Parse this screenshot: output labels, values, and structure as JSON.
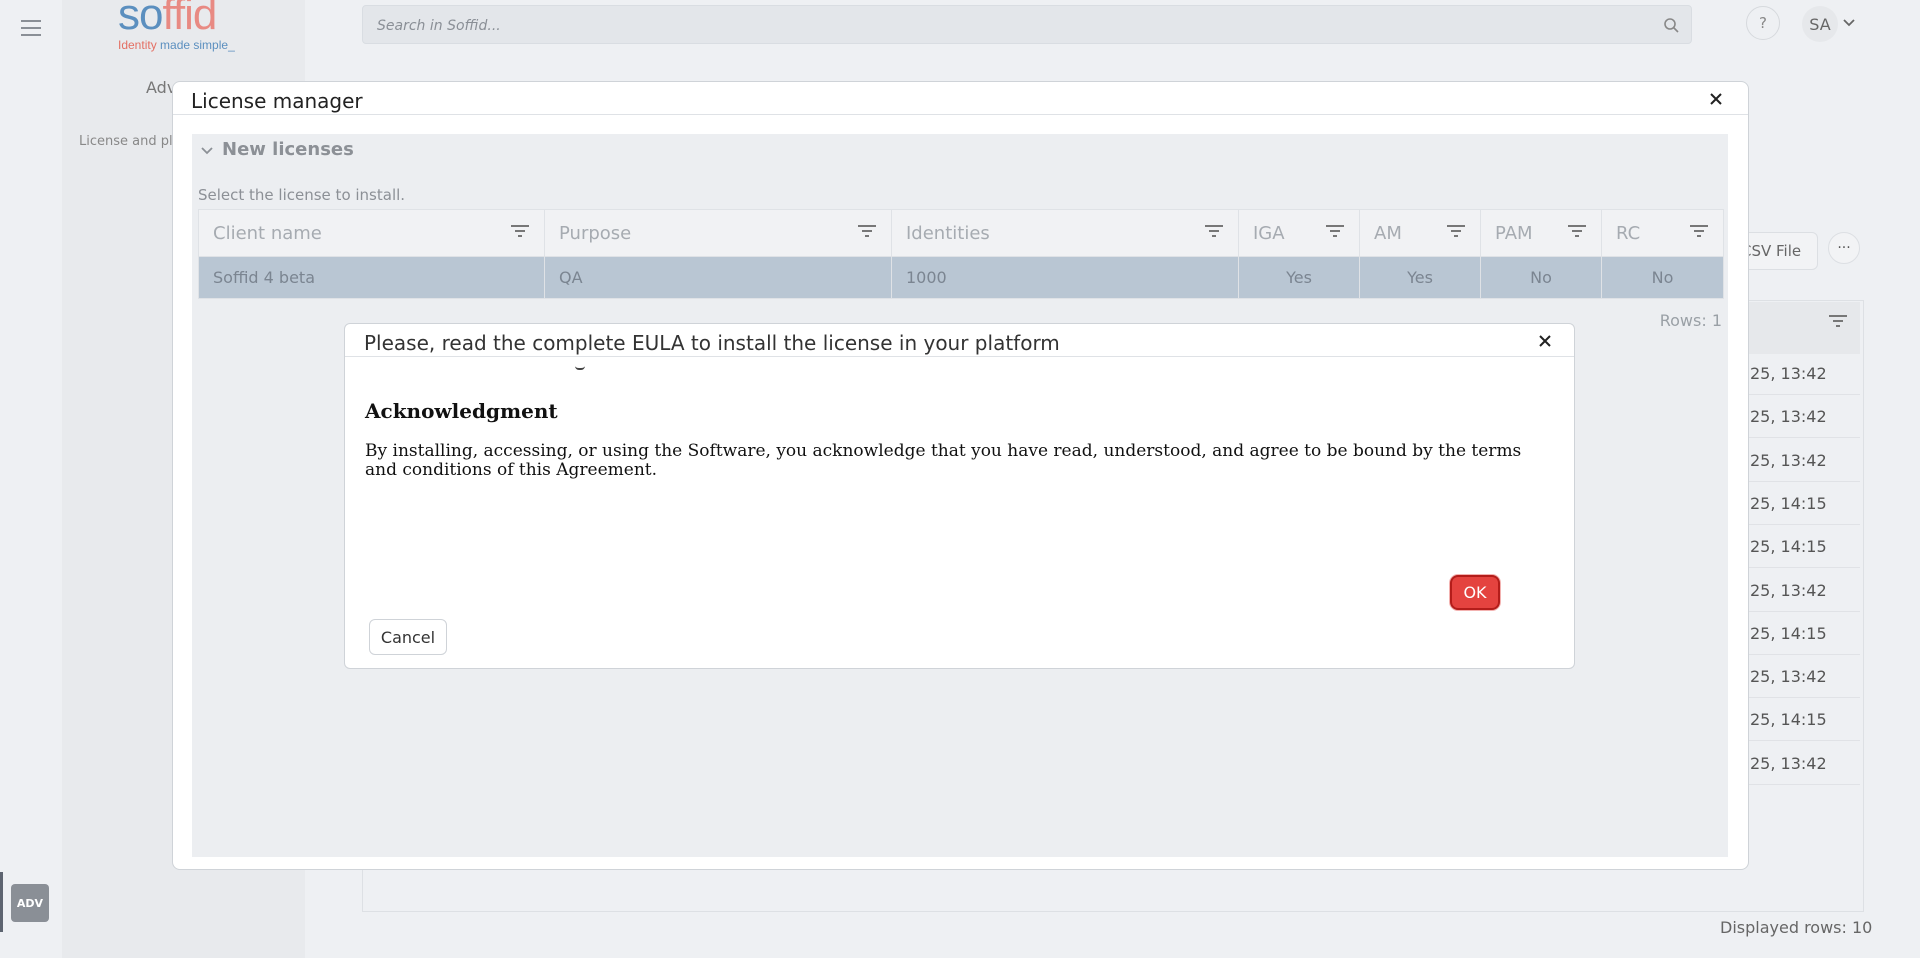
{
  "app": {
    "logo": {
      "text_main": "so",
      "text_accent": "ffid",
      "tagline_accent": "Identity",
      "tagline_rest": " made simple_"
    },
    "search": {
      "placeholder": "Search in Soffid..."
    },
    "header": {
      "help": "?",
      "user_initials": "SA"
    },
    "rail": {
      "badge": "ADV"
    },
    "sidenav": {
      "item1": "Adv",
      "item2": "License and pl"
    }
  },
  "background": {
    "csv_button": "CSV File",
    "more_button": "···",
    "rows": [
      "25, 13:42",
      "25, 13:42",
      "25, 13:42",
      "25, 14:15",
      "25, 14:15",
      "25, 13:42",
      "25, 14:15",
      "25, 13:42",
      "25, 14:15",
      "25, 13:42"
    ],
    "displayed_rows": "Displayed rows: 10"
  },
  "license_manager": {
    "title": "License manager",
    "section_title": "New licenses",
    "instruction": "Select the license to install.",
    "columns": [
      "Client name",
      "Purpose",
      "Identities",
      "IGA",
      "AM",
      "PAM",
      "RC"
    ],
    "rows": [
      [
        "Soffid 4 beta",
        "QA",
        "1000",
        "Yes",
        "Yes",
        "No",
        "No"
      ]
    ],
    "rows_count": "Rows: 1"
  },
  "eula_dialog": {
    "title": "Please, read the complete EULA to install the license in your platform",
    "heading": "Acknowledgment",
    "body": "By installing, accessing, or using the Software, you acknowledge that you have read, understood, and agree to be bound by the terms and conditions of this Agreement.",
    "ok_label": "OK",
    "cancel_label": "Cancel"
  },
  "colors": {
    "accent_red": "#e4433f",
    "selected_row": "#b9c6d3",
    "logo_blue": "#5b8fbf",
    "logo_salmon": "#e88a83"
  }
}
